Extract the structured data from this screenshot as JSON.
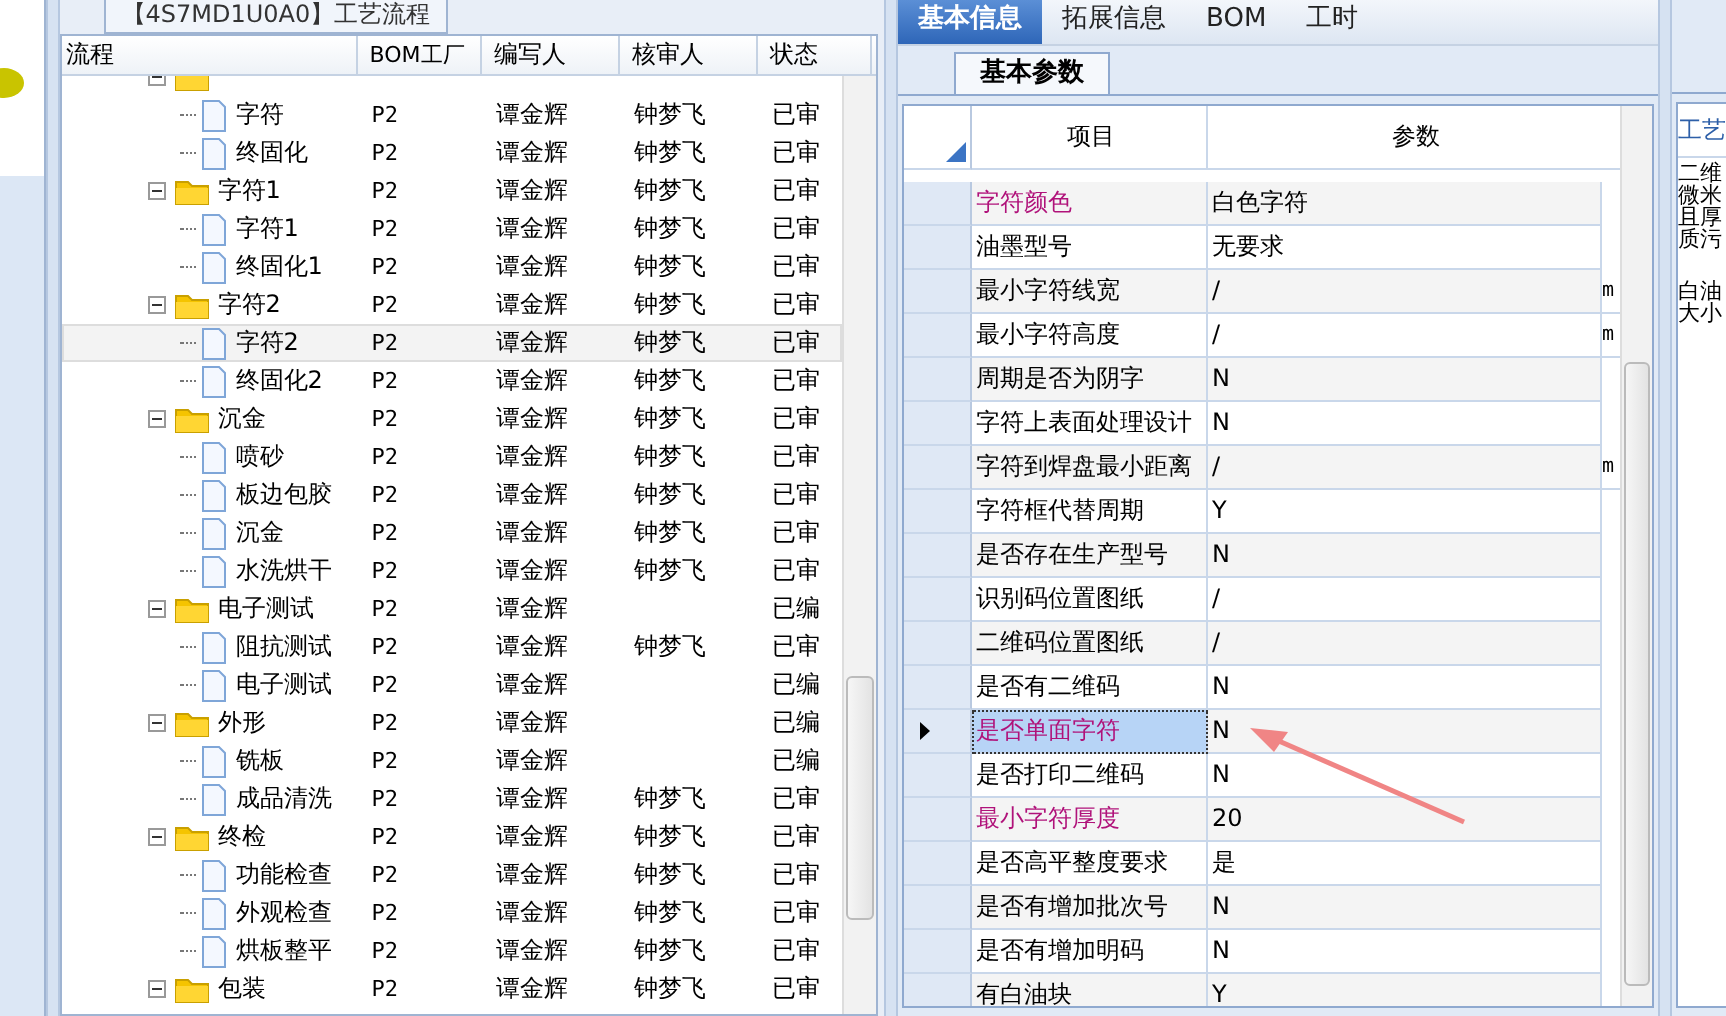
{
  "flow_panel": {
    "title": "【4S7MD1U0A0】工艺流程",
    "columns": [
      "流程",
      "BOM工厂",
      "编写人",
      "核审人",
      "状态"
    ],
    "tree": [
      {
        "expanded": true,
        "selected": false,
        "children": [
          {
            "label": "字符",
            "factory": "P2",
            "writer": "谭金辉",
            "reviewer": "钟梦飞",
            "status": "已审",
            "selected": false
          },
          {
            "label": "终固化",
            "factory": "P2",
            "writer": "谭金辉",
            "reviewer": "钟梦飞",
            "status": "已审",
            "selected": false
          }
        ]
      },
      {
        "label": "字符1",
        "factory": "P2",
        "writer": "谭金辉",
        "reviewer": "钟梦飞",
        "status": "已审",
        "expanded": true,
        "selected": false,
        "children": [
          {
            "label": "字符1",
            "factory": "P2",
            "writer": "谭金辉",
            "reviewer": "钟梦飞",
            "status": "已审",
            "selected": false
          },
          {
            "label": "终固化1",
            "factory": "P2",
            "writer": "谭金辉",
            "reviewer": "钟梦飞",
            "status": "已审",
            "selected": false
          }
        ]
      },
      {
        "label": "字符2",
        "factory": "P2",
        "writer": "谭金辉",
        "reviewer": "钟梦飞",
        "status": "已审",
        "expanded": true,
        "selected": false,
        "children": [
          {
            "label": "字符2",
            "factory": "P2",
            "writer": "谭金辉",
            "reviewer": "钟梦飞",
            "status": "已审",
            "selected": true
          },
          {
            "label": "终固化2",
            "factory": "P2",
            "writer": "谭金辉",
            "reviewer": "钟梦飞",
            "status": "已审",
            "selected": false
          }
        ]
      },
      {
        "label": "沉金",
        "factory": "P2",
        "writer": "谭金辉",
        "reviewer": "钟梦飞",
        "status": "已审",
        "expanded": true,
        "selected": false,
        "children": [
          {
            "label": "喷砂",
            "factory": "P2",
            "writer": "谭金辉",
            "reviewer": "钟梦飞",
            "status": "已审",
            "selected": false
          },
          {
            "label": "板边包胶",
            "factory": "P2",
            "writer": "谭金辉",
            "reviewer": "钟梦飞",
            "status": "已审",
            "selected": false
          },
          {
            "label": "沉金",
            "factory": "P2",
            "writer": "谭金辉",
            "reviewer": "钟梦飞",
            "status": "已审",
            "selected": false
          },
          {
            "label": "水洗烘干",
            "factory": "P2",
            "writer": "谭金辉",
            "reviewer": "钟梦飞",
            "status": "已审",
            "selected": false
          }
        ]
      },
      {
        "label": "电子测试",
        "factory": "P2",
        "writer": "谭金辉",
        "status": "已编",
        "expanded": true,
        "selected": false,
        "children": [
          {
            "label": "阻抗测试",
            "factory": "P2",
            "writer": "谭金辉",
            "reviewer": "钟梦飞",
            "status": "已审",
            "selected": false
          },
          {
            "label": "电子测试",
            "factory": "P2",
            "writer": "谭金辉",
            "status": "已编",
            "selected": false
          }
        ]
      },
      {
        "label": "外形",
        "factory": "P2",
        "writer": "谭金辉",
        "status": "已编",
        "expanded": true,
        "selected": false,
        "children": [
          {
            "label": "铣板",
            "factory": "P2",
            "writer": "谭金辉",
            "status": "已编",
            "selected": false
          },
          {
            "label": "成品清洗",
            "factory": "P2",
            "writer": "谭金辉",
            "reviewer": "钟梦飞",
            "status": "已审",
            "selected": false
          }
        ]
      },
      {
        "label": "终检",
        "factory": "P2",
        "writer": "谭金辉",
        "reviewer": "钟梦飞",
        "status": "已审",
        "expanded": true,
        "selected": false,
        "children": [
          {
            "label": "功能检查",
            "factory": "P2",
            "writer": "谭金辉",
            "reviewer": "钟梦飞",
            "status": "已审",
            "selected": false
          },
          {
            "label": "外观检查",
            "factory": "P2",
            "writer": "谭金辉",
            "reviewer": "钟梦飞",
            "status": "已审",
            "selected": false
          },
          {
            "label": "烘板整平",
            "factory": "P2",
            "writer": "谭金辉",
            "reviewer": "钟梦飞",
            "status": "已审",
            "selected": false
          }
        ]
      },
      {
        "label": "包装",
        "factory": "P2",
        "writer": "谭金辉",
        "reviewer": "钟梦飞",
        "status": "已审",
        "expanded": true,
        "selected": false
      }
    ]
  },
  "detail_panel": {
    "tabs": [
      {
        "label": "基本信息",
        "selected": true
      },
      {
        "label": "拓展信息",
        "selected": false
      },
      {
        "label": "BOM",
        "selected": false
      },
      {
        "label": "工时",
        "selected": false
      }
    ],
    "sub_tab": "基本参数",
    "columns": [
      "项目",
      "参数"
    ],
    "rows": [
      {
        "item": "字符颜色",
        "value": "白色字符",
        "emphasis": true,
        "selected": false
      },
      {
        "item": "油墨型号",
        "value": "无要求",
        "emphasis": false,
        "selected": false
      },
      {
        "item": "最小字符线宽",
        "value": "/",
        "unit": "m",
        "emphasis": false,
        "selected": false
      },
      {
        "item": "最小字符高度",
        "value": "/",
        "unit": "m",
        "emphasis": false,
        "selected": false
      },
      {
        "item": "周期是否为阴字",
        "value": "N",
        "emphasis": false,
        "selected": false
      },
      {
        "item": "字符上表面处理设计",
        "value": "N",
        "emphasis": false,
        "selected": false
      },
      {
        "item": "字符到焊盘最小距离",
        "value": "/",
        "unit": "m",
        "emphasis": false,
        "selected": false
      },
      {
        "item": "字符框代替周期",
        "value": "Y",
        "emphasis": false,
        "selected": false
      },
      {
        "item": "是否存在生产型号",
        "value": "N",
        "emphasis": false,
        "selected": false
      },
      {
        "item": "识别码位置图纸",
        "value": "/",
        "emphasis": false,
        "selected": false
      },
      {
        "item": "二维码位置图纸",
        "value": "/",
        "emphasis": false,
        "selected": false
      },
      {
        "item": "是否有二维码",
        "value": "N",
        "emphasis": false,
        "selected": false
      },
      {
        "item": "是否单面字符",
        "value": "N",
        "emphasis": true,
        "selected": true
      },
      {
        "item": "是否打印二维码",
        "value": "N",
        "emphasis": false,
        "selected": false
      },
      {
        "item": "最小字符厚度",
        "value": "20",
        "emphasis": true,
        "selected": false
      },
      {
        "item": "是否高平整度要求",
        "value": "是",
        "emphasis": false,
        "selected": false
      },
      {
        "item": "是否有增加批次号",
        "value": "N",
        "emphasis": false,
        "selected": false
      },
      {
        "item": "是否有增加明码",
        "value": "N",
        "emphasis": false,
        "selected": false
      },
      {
        "item": "有白油块",
        "value": "Y",
        "emphasis": false,
        "selected": false
      }
    ],
    "annotations": [
      {
        "kind": "arrow"
      }
    ]
  },
  "side_panel": {
    "header": "工艺",
    "lines": [
      "二维",
      "微米",
      "且厚",
      "质污",
      "白油",
      "大小"
    ]
  }
}
